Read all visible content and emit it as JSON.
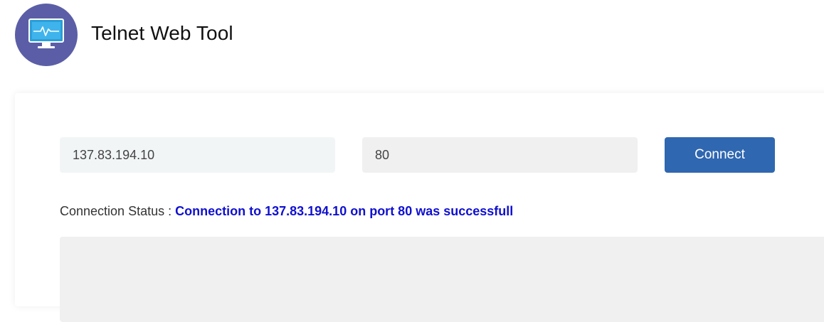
{
  "app": {
    "title": "Telnet Web Tool",
    "logo_icon": "monitor-pulse-icon"
  },
  "form": {
    "host_value": "137.83.194.10",
    "port_value": "80",
    "connect_label": "Connect"
  },
  "status": {
    "label": "Connection Status : ",
    "message": "Connection to 137.83.194.10 on port 80 was successfull"
  },
  "output": {
    "text": ""
  },
  "colors": {
    "logo_bg": "#5b5ea6",
    "button_bg": "#2f67b1",
    "status_text": "#1010d0"
  }
}
